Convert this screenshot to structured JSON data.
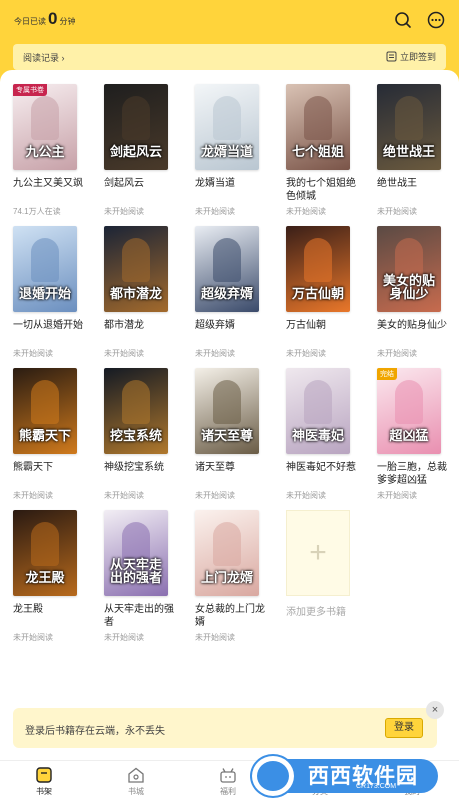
{
  "header": {
    "today_prefix": "今日已读",
    "today_minutes": "0",
    "today_unit": "分钟",
    "search_icon": "search-icon",
    "more_icon": "more-icon",
    "reading_record": "阅读记录 ›",
    "checkin_label": "立即签到"
  },
  "books": [
    {
      "title": "九公主又美又飒",
      "status": "74.1万人在读",
      "badge": "专属书卷",
      "cover_text": "九公主",
      "colors": [
        "#f7eef0",
        "#c7a1a8"
      ],
      "badge_color": "#c7254e"
    },
    {
      "title": "剑起风云",
      "status": "未开始阅读",
      "cover_text": "剑起风云",
      "colors": [
        "#1e1e1e",
        "#4a3a2a"
      ]
    },
    {
      "title": "龙婿当道",
      "status": "未开始阅读",
      "cover_text": "龙婿当道",
      "colors": [
        "#f3f6f8",
        "#b9c6d1"
      ]
    },
    {
      "title": "我的七个姐姐绝色倾城",
      "status": "未开始阅读",
      "cover_text": "七个姐姐",
      "colors": [
        "#d9c2b4",
        "#7a5448"
      ]
    },
    {
      "title": "绝世战王",
      "status": "未开始阅读",
      "cover_text": "绝世战王",
      "colors": [
        "#262b36",
        "#6b5a3e"
      ]
    },
    {
      "title": "一切从退婚开始",
      "status": "未开始阅读",
      "cover_text": "退婚开始",
      "colors": [
        "#cfe1f3",
        "#6b8fbf"
      ]
    },
    {
      "title": "都市潜龙",
      "status": "未开始阅读",
      "cover_text": "都市潜龙",
      "colors": [
        "#1b2436",
        "#a36a2c"
      ]
    },
    {
      "title": "超级弃婿",
      "status": "未开始阅读",
      "cover_text": "超级弃婿",
      "colors": [
        "#e9edf3",
        "#3a4a6a"
      ]
    },
    {
      "title": "万古仙朝",
      "status": "未开始阅读",
      "cover_text": "万古仙朝",
      "colors": [
        "#3a1f18",
        "#e9772a"
      ]
    },
    {
      "title": "美女的贴身仙少",
      "status": "未开始阅读",
      "cover_text": "美女的贴身仙少",
      "colors": [
        "#5a4a44",
        "#c76b4e"
      ]
    },
    {
      "title": "熊霸天下",
      "status": "未开始阅读",
      "cover_text": "熊霸天下",
      "colors": [
        "#2a1c12",
        "#d07a1c"
      ]
    },
    {
      "title": "神级挖宝系统",
      "status": "未开始阅读",
      "cover_text": "挖宝系统",
      "colors": [
        "#141a24",
        "#b0782c"
      ]
    },
    {
      "title": "诸天至尊",
      "status": "未开始阅读",
      "cover_text": "诸天至尊",
      "colors": [
        "#f4f0e8",
        "#6a5c46"
      ]
    },
    {
      "title": "神医毒妃不好惹",
      "status": "未开始阅读",
      "cover_text": "神医毒妃",
      "colors": [
        "#efe8ee",
        "#b8a4c0"
      ]
    },
    {
      "title": "一胎三胞，总裁爹爹超凶猛",
      "status": "未开始阅读",
      "badge": "完结",
      "cover_text": "超凶猛",
      "colors": [
        "#fbe9ef",
        "#e98fb0"
      ],
      "badge_color": "#f0a500"
    },
    {
      "title": "龙王殿",
      "status": "未开始阅读",
      "cover_text": "龙王殿",
      "colors": [
        "#2a1a12",
        "#b86a1c"
      ]
    },
    {
      "title": "从天牢走出的强者",
      "status": "未开始阅读",
      "cover_text": "从天牢走出的强者",
      "colors": [
        "#f2eef4",
        "#8a6fb0"
      ]
    },
    {
      "title": "女总裁的上门龙婿",
      "status": "未开始阅读",
      "cover_text": "上门龙婿",
      "colors": [
        "#fbf2ee",
        "#d9a8a0"
      ]
    }
  ],
  "add_more_label": "添加更多书籍",
  "login_banner": {
    "text": "登录后书籍存在云端，永不丢失",
    "button": "登录",
    "close": "×"
  },
  "tabs": [
    {
      "label": "书架",
      "icon": "bookshelf-icon",
      "active": true
    },
    {
      "label": "书城",
      "icon": "bookstore-icon"
    },
    {
      "label": "福利",
      "icon": "gift-icon"
    },
    {
      "label": "分类",
      "icon": "category-icon"
    },
    {
      "label": "我的",
      "icon": "profile-icon"
    }
  ],
  "watermark": {
    "brand": "西西软件园",
    "url": "CR173.COM"
  },
  "colors": {
    "accent": "#ffd43b",
    "accent_light": "#fff6cc",
    "watermark_blue": "#3b8fe5"
  }
}
